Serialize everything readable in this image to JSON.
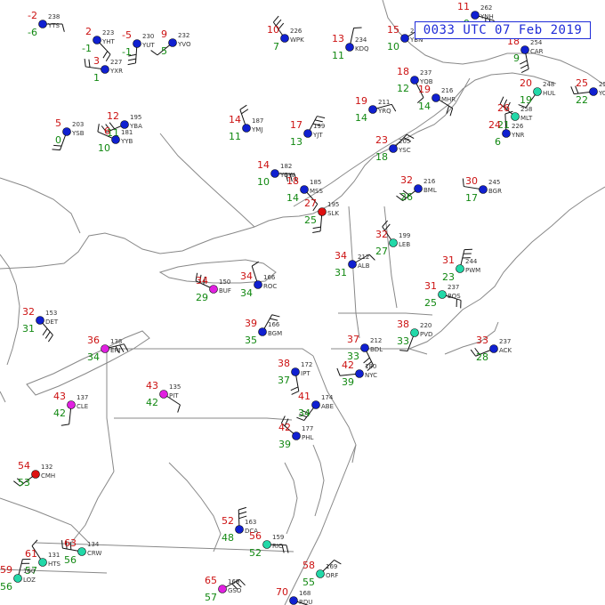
{
  "title": "0033 UTC 07 Feb 2019",
  "colors": {
    "temp": "#cc1111",
    "dew": "#118811",
    "wx": "#cc11cc",
    "station_blue": "#1020d0",
    "station_cyan": "#22d8a8",
    "station_red": "#dd1111",
    "station_magenta": "#e020e0",
    "border": "#888888",
    "barb": "#111111"
  },
  "stations": [
    {
      "id": "YTS",
      "t": "-2",
      "d": "-6",
      "p": "238",
      "c": "blue"
    },
    {
      "id": "YHT",
      "t": "2",
      "d": "-1",
      "p": "223",
      "c": "blue"
    },
    {
      "id": "YUT",
      "t": "-5",
      "d": "-1",
      "p": "230",
      "c": "blue"
    },
    {
      "id": "YVO",
      "t": "9",
      "d": "5",
      "p": "232",
      "c": "blue"
    },
    {
      "id": "YXR",
      "t": "3",
      "d": "1",
      "p": "227",
      "c": "blue"
    },
    {
      "id": "WPK",
      "t": "10",
      "d": "7",
      "p": "226",
      "c": "blue"
    },
    {
      "id": "KDQ",
      "t": "13",
      "d": "11",
      "p": "234",
      "c": "blue"
    },
    {
      "id": "YBN",
      "t": "15",
      "d": "10",
      "p": "239",
      "c": "blue"
    },
    {
      "id": "YNH",
      "t": "11",
      "d": "9",
      "p": "262",
      "c": "blue"
    },
    {
      "id": "YQB",
      "t": "18",
      "d": "12",
      "p": "237",
      "c": "blue"
    },
    {
      "id": "YSB",
      "t": "5",
      "d": "0",
      "p": "203",
      "c": "blue"
    },
    {
      "id": "YBA",
      "t": "12",
      "d": "11",
      "p": "195",
      "c": "blue"
    },
    {
      "id": "YYB",
      "t": "6",
      "d": "10",
      "p": "181",
      "c": "blue"
    },
    {
      "id": "YMJ",
      "t": "14",
      "d": "11",
      "p": "187",
      "c": "blue"
    },
    {
      "id": "YJT",
      "t": "17",
      "d": "13",
      "p": "199",
      "c": "blue"
    },
    {
      "id": "YRQ",
      "t": "19",
      "d": "14",
      "p": "211",
      "c": "blue"
    },
    {
      "id": "MHR",
      "t": "19",
      "d": "14",
      "p": "216",
      "c": "blue"
    },
    {
      "id": "CAR",
      "t": "18",
      "d": "9",
      "p": "254",
      "c": "blue"
    },
    {
      "id": "HUL",
      "t": "20",
      "d": "19",
      "p": "248",
      "c": "cyan"
    },
    {
      "id": "YCX",
      "t": "25",
      "d": "22",
      "p": "256",
      "c": "blue"
    },
    {
      "id": "MLT",
      "t": "26",
      "d": "21",
      "p": "258",
      "c": "cyan"
    },
    {
      "id": "YNR",
      "t": "24",
      "d": "6",
      "p": "226",
      "c": "blue"
    },
    {
      "id": "YSC",
      "t": "23",
      "d": "18",
      "p": "205",
      "c": "blue"
    },
    {
      "id": "YOW",
      "t": "14",
      "d": "10",
      "p": "182",
      "c": "blue"
    },
    {
      "id": "MSS",
      "t": "18",
      "d": "14",
      "p": "185",
      "c": "blue"
    },
    {
      "id": "SLK",
      "t": "27",
      "d": "25",
      "p": "195",
      "c": "red"
    },
    {
      "id": "BML",
      "t": "32",
      "d": "26",
      "p": "216",
      "c": "blue"
    },
    {
      "id": "BGR",
      "t": "30",
      "d": "17",
      "p": "245",
      "c": "blue"
    },
    {
      "id": "LEB",
      "t": "32",
      "d": "27",
      "p": "199",
      "c": "cyan"
    },
    {
      "id": "PWM",
      "t": "31",
      "d": "23",
      "p": "244",
      "c": "cyan"
    },
    {
      "id": "ALB",
      "t": "34",
      "d": "31",
      "p": "212",
      "c": "blue"
    },
    {
      "id": "BOS",
      "t": "31",
      "d": "25",
      "p": "237",
      "c": "cyan"
    },
    {
      "id": "BDL",
      "t": "37",
      "d": "33",
      "p": "212",
      "c": "blue"
    },
    {
      "id": "PVD",
      "t": "38",
      "d": "33",
      "p": "220",
      "c": "cyan"
    },
    {
      "id": "ACK",
      "t": "33",
      "d": "28",
      "p": "237",
      "c": "blue"
    },
    {
      "id": "BUF",
      "t": "34",
      "d": "29",
      "p": "150",
      "c": "magenta"
    },
    {
      "id": "ROC",
      "t": "34",
      "d": "34",
      "p": "166",
      "c": "blue"
    },
    {
      "id": "BGM",
      "t": "39",
      "d": "35",
      "p": "166",
      "c": "blue"
    },
    {
      "id": "ERI",
      "t": "36",
      "d": "34",
      "p": "138",
      "c": "magenta"
    },
    {
      "id": "PIT",
      "t": "43",
      "d": "42",
      "p": "135",
      "c": "magenta"
    },
    {
      "id": "IPT",
      "t": "38",
      "d": "37",
      "p": "172",
      "c": "blue"
    },
    {
      "id": "ABE",
      "t": "41",
      "d": "34",
      "p": "174",
      "c": "blue"
    },
    {
      "id": "NYC",
      "t": "42",
      "d": "39",
      "p": "180",
      "c": "blue"
    },
    {
      "id": "PHL",
      "t": "42",
      "d": "39",
      "p": "177",
      "c": "blue"
    },
    {
      "id": "DCA",
      "t": "52",
      "d": "48",
      "p": "163",
      "c": "blue"
    },
    {
      "id": "ORF",
      "t": "58",
      "d": "55",
      "p": "169",
      "c": "cyan"
    },
    {
      "id": "RIC",
      "t": "56",
      "d": "52",
      "p": "159",
      "c": "cyan"
    },
    {
      "id": "DET",
      "t": "32",
      "d": "31",
      "p": "153",
      "c": "blue"
    },
    {
      "id": "CLE",
      "t": "43",
      "d": "42",
      "p": "137",
      "c": "magenta"
    },
    {
      "id": "CMH",
      "t": "54",
      "d": "53",
      "p": "132",
      "c": "red"
    },
    {
      "id": "CRW",
      "t": "63",
      "d": "56",
      "p": "134",
      "c": "cyan"
    },
    {
      "id": "HTS",
      "t": "61",
      "d": "57",
      "p": "131",
      "c": "cyan"
    },
    {
      "id": "LOZ",
      "t": "59",
      "d": "56",
      "p": "160",
      "c": "cyan"
    },
    {
      "id": "GSO",
      "t": "65",
      "d": "57",
      "p": "169",
      "c": "magenta"
    },
    {
      "id": "RDU",
      "t": "70",
      "d": "64",
      "p": "168",
      "c": "blue"
    }
  ]
}
